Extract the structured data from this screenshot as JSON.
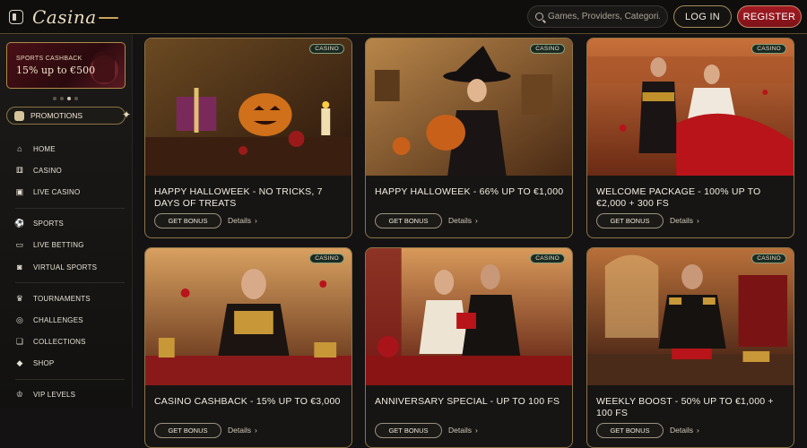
{
  "topbar": {
    "logo_text": "Casina",
    "search_placeholder": "Games, Providers, Categori...",
    "login_label": "LOG IN",
    "register_label": "REGISTER"
  },
  "sidebar": {
    "banner": {
      "line1": "SPORTS CASHBACK",
      "line2": "15% up to €500"
    },
    "promotions_label": "PROMOTIONS",
    "groups": [
      [
        {
          "label": "HOME",
          "icon": "home-icon"
        },
        {
          "label": "CASINO",
          "icon": "dice-icon"
        },
        {
          "label": "LIVE CASINO",
          "icon": "live-cards-icon"
        }
      ],
      [
        {
          "label": "SPORTS",
          "icon": "ball-icon"
        },
        {
          "label": "LIVE BETTING",
          "icon": "live-tv-icon"
        },
        {
          "label": "VIRTUAL SPORTS",
          "icon": "virtual-icon"
        }
      ],
      [
        {
          "label": "TOURNAMENTS",
          "icon": "trophy-icon"
        },
        {
          "label": "CHALLENGES",
          "icon": "target-icon"
        },
        {
          "label": "COLLECTIONS",
          "icon": "collection-icon"
        },
        {
          "label": "SHOP",
          "icon": "shop-icon"
        }
      ],
      [
        {
          "label": "VIP LEVELS",
          "icon": "crown-icon"
        }
      ]
    ]
  },
  "cards": [
    {
      "badge": "CASINO",
      "title": "HAPPY HALLOWEEK - NO TRICKS, 7 DAYS OF TREATS",
      "cta": "GET BONUS",
      "details": "Details"
    },
    {
      "badge": "CASINO",
      "title": "HAPPY HALLOWEEK - 66% UP TO €1,000",
      "cta": "GET BONUS",
      "details": "Details"
    },
    {
      "badge": "CASINO",
      "title": "WELCOME PACKAGE - 100% UP TO €2,000 + 300 FS",
      "cta": "GET BONUS",
      "details": "Details"
    },
    {
      "badge": "CASINO",
      "title": "CASINO CASHBACK - 15% UP TO €3,000",
      "cta": "GET BONUS",
      "details": "Details"
    },
    {
      "badge": "CASINO",
      "title": "ANNIVERSARY SPECIAL - UP TO 100 FS",
      "cta": "GET BONUS",
      "details": "Details"
    },
    {
      "badge": "CASINO",
      "title": "WEEKLY BOOST - 50% UP TO €1,000 + 100 FS",
      "cta": "GET BONUS",
      "details": "Details"
    }
  ]
}
